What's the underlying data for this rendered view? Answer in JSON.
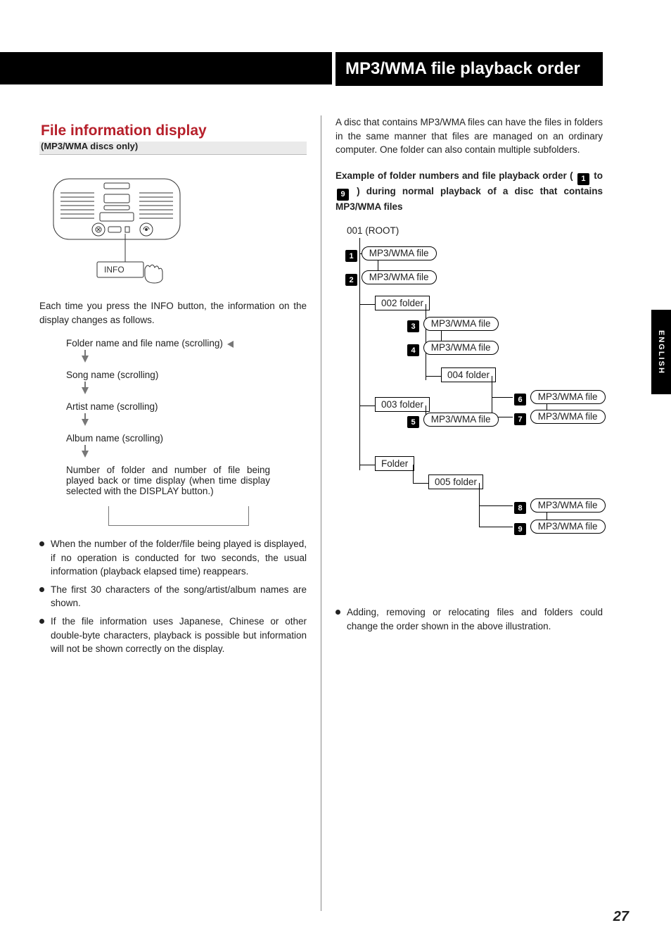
{
  "side_tab": "ENGLISH",
  "page_number": "27",
  "left": {
    "section": {
      "title": "File information display",
      "subtitle": "(MP3/WMA discs only)"
    },
    "info_button_label": "INFO",
    "intro": "Each time you press the INFO button, the information on the display changes as follows.",
    "flow": {
      "s1": "Folder name and file name (scrolling)",
      "s2": "Song name (scrolling)",
      "s3": "Artist name (scrolling)",
      "s4": "Album name (scrolling)",
      "s5": "Number of folder and number of file being played back or time display (when time display selected with the DISPLAY button.)"
    },
    "bullets": {
      "b1": "When the number of the folder/file being played is displayed, if no operation is conducted for two seconds, the usual information (playback elapsed time) reappears.",
      "b2": "The first 30 characters of the song/artist/album names are shown.",
      "b3": "If the file information uses Japanese, Chinese or other double-byte characters, playback is possible but information will not be shown correctly on the display."
    }
  },
  "right": {
    "title": "MP3/WMA file playback order",
    "intro": "A disc that contains MP3/WMA files can have the files in folders in the same manner that files are managed on an ordinary computer. One folder can also contain multiple subfolders.",
    "example": {
      "pre": "Example of folder numbers and file playback order ( ",
      "mid": " to ",
      "post": " ) during normal playback of a disc that contains MP3/WMA files",
      "from": "1",
      "to": "9"
    },
    "tree": {
      "root": "001 (ROOT)",
      "file_label": "MP3/WMA file",
      "f002": "002 folder",
      "f003": "003 folder",
      "f004": "004 folder",
      "f005": "005 folder",
      "folder_empty": "Folder"
    },
    "note": "Adding, removing or relocating files and folders could change the order shown in the above illustration."
  }
}
